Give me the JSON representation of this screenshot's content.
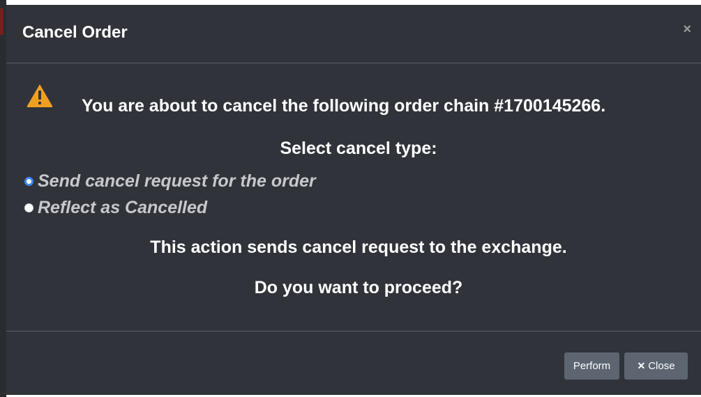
{
  "modal": {
    "title": "Cancel Order",
    "close_icon": "×"
  },
  "body": {
    "warning_icon": "warning-triangle-icon",
    "chain_message": "You are about to cancel the following order chain #1700145266.",
    "select_label": "Select cancel type:",
    "options": [
      {
        "label": "Send cancel request for the order",
        "checked": true
      },
      {
        "label": "Reflect as Cancelled",
        "checked": false
      }
    ],
    "action_message": "This action sends cancel request to the exchange.",
    "proceed_message": "Do you want to proceed?"
  },
  "footer": {
    "perform_label": "Perform",
    "close_label": "Close",
    "close_glyph": "✕"
  },
  "colors": {
    "modal_bg": "#31333a",
    "warning": "#f0a020",
    "radio_checked": "#3a86f0",
    "button_bg": "#5c6570"
  }
}
